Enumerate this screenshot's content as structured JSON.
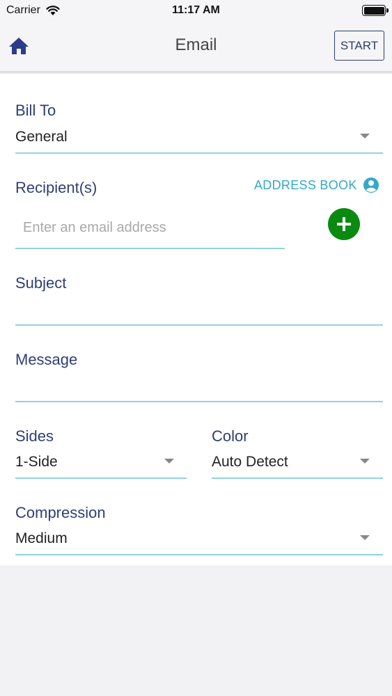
{
  "status_bar": {
    "carrier": "Carrier",
    "time": "11:17 AM"
  },
  "nav": {
    "title": "Email",
    "start_label": "START",
    "home_icon": "home-icon"
  },
  "form": {
    "bill_to": {
      "label": "Bill To",
      "value": "General"
    },
    "recipients": {
      "label": "Recipient(s)",
      "address_book_label": "ADDRESS BOOK",
      "placeholder": "Enter an email address",
      "value": ""
    },
    "subject": {
      "label": "Subject",
      "value": ""
    },
    "message": {
      "label": "Message",
      "value": ""
    },
    "sides": {
      "label": "Sides",
      "value": "1-Side"
    },
    "color": {
      "label": "Color",
      "value": "Auto Detect"
    },
    "compression": {
      "label": "Compression",
      "value": "Medium"
    }
  },
  "colors": {
    "accent": "#2e3f72",
    "link": "#32a9c9",
    "underline": "#8fd3e0",
    "add_button": "#0a8a10"
  }
}
